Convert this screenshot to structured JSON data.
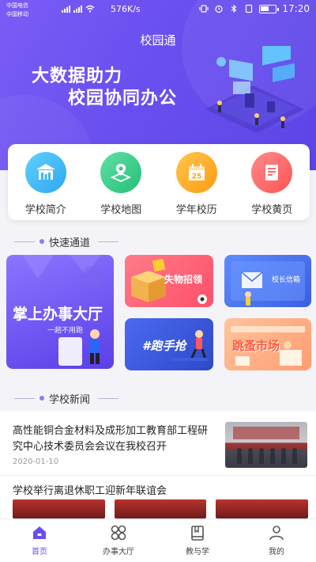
{
  "status_bar": {
    "carrier1": "中国电信",
    "carrier2": "中国移动",
    "net_speed": "576K/s",
    "time": "17:20"
  },
  "header": {
    "app_title": "校园通",
    "slogan_line1": "大数据助力",
    "slogan_line2": "校园协同办公"
  },
  "quick_entries": [
    {
      "label": "学校简介",
      "icon": "school-building-icon",
      "color": "#3fb6f5"
    },
    {
      "label": "学校地图",
      "icon": "map-pin-icon",
      "color": "#3fd08e"
    },
    {
      "label": "学年校历",
      "icon": "calendar-icon",
      "color": "#ffb02e"
    },
    {
      "label": "学校黄页",
      "icon": "phonebook-icon",
      "color": "#ff6a6a"
    }
  ],
  "calendar_day": "25",
  "quick_channel": {
    "section_title": "快速通道",
    "big_card_title": "掌上办事大厅",
    "big_card_subtitle": "一趟不用跑",
    "lost_found": "失物招领",
    "principal_mailbox": "校长信箱",
    "runner": "#跑手抢",
    "flea_market": "跳蚤市场"
  },
  "news": {
    "section_title": "学校新闻",
    "items": [
      {
        "title": "高性能铜合金材料及成形加工教育部工程研究中心技术委员会会议在我校召开",
        "date": "2020-01-10"
      },
      {
        "title": "学校举行离退休职工迎新年联谊会"
      }
    ]
  },
  "tabbar": {
    "items": [
      {
        "label": "首页",
        "icon": "home-icon",
        "active": true
      },
      {
        "label": "办事大厅",
        "icon": "grid-icon",
        "active": false
      },
      {
        "label": "教与学",
        "icon": "book-icon",
        "active": false
      },
      {
        "label": "我的",
        "icon": "user-icon",
        "active": false
      }
    ]
  },
  "colors": {
    "accent": "#6a4ff0",
    "header_gradient_start": "#7b5cf5",
    "header_gradient_end": "#5b45e6"
  }
}
